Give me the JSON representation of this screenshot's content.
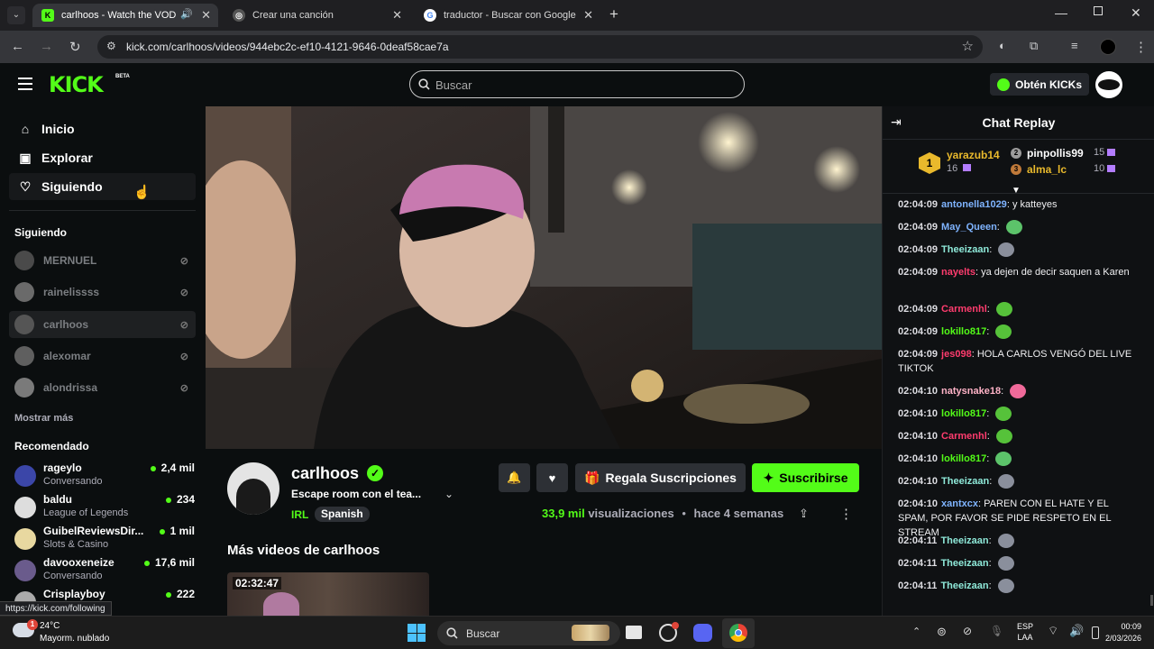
{
  "browser": {
    "tabs": [
      {
        "title": "carlhoos - Watch the VOD d",
        "favicon": "K",
        "active": true
      },
      {
        "title": "Crear una canción",
        "favicon": "◎",
        "active": false
      },
      {
        "title": "traductor - Buscar con Google",
        "favicon": "G",
        "active": false
      }
    ],
    "url": "kick.com/carlhoos/videos/944ebc2c-ef10-4121-9646-0deaf58cae7a",
    "status_url": "https://kick.com/following"
  },
  "header": {
    "logo": "KICK",
    "beta": "BETA",
    "search_placeholder": "Buscar",
    "kicks_button": "Obtén KICKs"
  },
  "sidebar": {
    "nav": [
      {
        "label": "Inicio",
        "icon": "home-icon"
      },
      {
        "label": "Explorar",
        "icon": "explore-icon"
      },
      {
        "label": "Siguiendo",
        "icon": "heart-icon"
      }
    ],
    "following_title": "Siguiendo",
    "following": [
      "MERNUEL",
      "rainelissss",
      "carlhoos",
      "alexomar",
      "alondrissa"
    ],
    "show_more": "Mostrar más",
    "recommended_title": "Recomendado",
    "recommended": [
      {
        "name": "rageylo",
        "category": "Conversando",
        "viewers": "2,4 mil"
      },
      {
        "name": "baldu",
        "category": "League of Legends",
        "viewers": "234"
      },
      {
        "name": "GuibelReviewsDir...",
        "category": "Slots & Casino",
        "viewers": "1 mil"
      },
      {
        "name": "davooxeneize",
        "category": "Conversando",
        "viewers": "17,6 mil"
      },
      {
        "name": "Crisplayboy",
        "category": "",
        "viewers": "222"
      }
    ]
  },
  "channel": {
    "name": "carlhoos",
    "title": "Escape room con el tea...",
    "category": "IRL",
    "tag": "Spanish",
    "views_count": "33,9 mil",
    "views_label": "visualizaciones",
    "time_ago": "hace 4 semanas",
    "gift_label": "Regala Suscripciones",
    "subscribe_label": "Suscribirse",
    "more_videos_title": "Más videos de carlhoos",
    "thumb_duration": "02:32:47"
  },
  "chat": {
    "title": "Chat Replay",
    "leaders": [
      {
        "rank": "1",
        "name": "yarazub14",
        "count": "16"
      },
      {
        "rank": "2",
        "name": "pinpollis99",
        "count": "15"
      },
      {
        "rank": "3",
        "name": "alma_lc",
        "count": "10"
      }
    ],
    "messages": [
      {
        "ts": "02:04:09",
        "user": "antonella1029",
        "color": "#7fb4ff",
        "text": "y katteyes",
        "emote": ""
      },
      {
        "ts": "02:04:09",
        "user": "May_Queen",
        "color": "#7fb4ff",
        "text": "",
        "emote": "#5cc36a"
      },
      {
        "ts": "02:04:09",
        "user": "Theeizaan",
        "color": "#8ee8d8",
        "text": "",
        "emote": "#8a8f9c"
      },
      {
        "ts": "02:04:09",
        "user": "nayelts",
        "color": "#ff3c6e",
        "text": "ya dejen de decir saquen a Karen",
        "emote": ""
      },
      {
        "ts": "02:04:09",
        "user": "Carmenhl",
        "color": "#ff3c6e",
        "text": "",
        "emote": "#56c23a"
      },
      {
        "ts": "02:04:09",
        "user": "lokillo817",
        "color": "#53fc18",
        "text": "",
        "emote": "#56c23a"
      },
      {
        "ts": "02:04:09",
        "user": "jes098",
        "color": "#ff3c6e",
        "text": "HOLA CARLOS VENGÓ DEL LIVE TIKTOK",
        "emote": ""
      },
      {
        "ts": "02:04:10",
        "user": "natysnake18",
        "color": "#ffb3c7",
        "text": "",
        "emote": "#f06a9a"
      },
      {
        "ts": "02:04:10",
        "user": "lokillo817",
        "color": "#53fc18",
        "text": "",
        "emote": "#56c23a"
      },
      {
        "ts": "02:04:10",
        "user": "Carmenhl",
        "color": "#ff3c6e",
        "text": "",
        "emote": "#56c23a"
      },
      {
        "ts": "02:04:10",
        "user": "lokillo817",
        "color": "#53fc18",
        "text": "",
        "emote": "#5cc36a"
      },
      {
        "ts": "02:04:10",
        "user": "Theeizaan",
        "color": "#8ee8d8",
        "text": "",
        "emote": "#8a8f9c"
      },
      {
        "ts": "02:04:10",
        "user": "xantxcx",
        "color": "#7fb4ff",
        "text": "PAREN CON EL HATE Y EL SPAM, POR FAVOR SE PIDE RESPETO EN EL STREAM",
        "emote": ""
      },
      {
        "ts": "02:04:11",
        "user": "Theeizaan",
        "color": "#8ee8d8",
        "text": "",
        "emote": "#8a8f9c"
      },
      {
        "ts": "02:04:11",
        "user": "Theeizaan",
        "color": "#8ee8d8",
        "text": "",
        "emote": "#8a8f9c"
      },
      {
        "ts": "02:04:11",
        "user": "Theeizaan",
        "color": "#8ee8d8",
        "text": "",
        "emote": "#8a8f9c"
      }
    ]
  },
  "taskbar": {
    "weather_temp": "24°C",
    "weather_desc": "Mayorm. nublado",
    "weather_badge": "1",
    "search_label": "Buscar",
    "lang1": "ESP",
    "lang2": "LAA",
    "time": "00:09",
    "date": "2/03/2026"
  }
}
